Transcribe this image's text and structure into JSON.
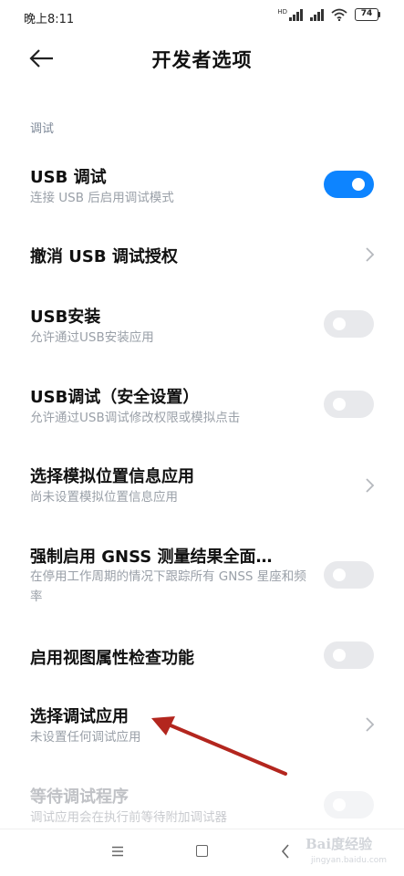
{
  "status_bar": {
    "time": "晚上8:11",
    "battery": "74",
    "icons": [
      "hd-signal-icon",
      "signal-icon",
      "wifi-icon",
      "battery-icon"
    ]
  },
  "header": {
    "back_icon": "arrow-left-icon",
    "title": "开发者选项"
  },
  "section": {
    "label": "调试"
  },
  "settings": [
    {
      "title": "USB 调试",
      "subtitle": "连接 USB 后启用调试模式",
      "control": "toggle",
      "state": "on",
      "enabled": true
    },
    {
      "title": "撤消 USB 调试授权",
      "subtitle": "",
      "control": "chevron",
      "enabled": true
    },
    {
      "title": "USB安装",
      "subtitle": "允许通过USB安装应用",
      "control": "toggle",
      "state": "off",
      "enabled": true
    },
    {
      "title": "USB调试（安全设置）",
      "subtitle": "允许通过USB调试修改权限或模拟点击",
      "control": "toggle",
      "state": "off",
      "enabled": true
    },
    {
      "title": "选择模拟位置信息应用",
      "subtitle": "尚未设置模拟位置信息应用",
      "control": "chevron",
      "enabled": true
    },
    {
      "title": "强制启用 GNSS 测量结果全面…",
      "subtitle": "在停用工作周期的情况下跟踪所有 GNSS 星座和频率",
      "control": "toggle",
      "state": "off",
      "enabled": true
    },
    {
      "title": "启用视图属性检查功能",
      "subtitle": "",
      "control": "toggle",
      "state": "off",
      "enabled": true
    },
    {
      "title": "选择调试应用",
      "subtitle": "未设置任何调试应用",
      "control": "chevron",
      "enabled": true
    },
    {
      "title": "等待调试程序",
      "subtitle": "调试应用会在执行前等待附加调试器",
      "control": "toggle",
      "state": "off",
      "enabled": false
    }
  ],
  "nav_bar": {
    "icons": [
      "menu-icon",
      "home-icon",
      "back-icon"
    ]
  },
  "watermark": {
    "logo": "Bai度经验",
    "sub": "jingyan.baidu.com"
  },
  "colors": {
    "accent": "#0d84ff",
    "annotation_arrow": "#b3261e",
    "subtitle": "#9aa0a8",
    "section_label": "#7f8a99"
  }
}
